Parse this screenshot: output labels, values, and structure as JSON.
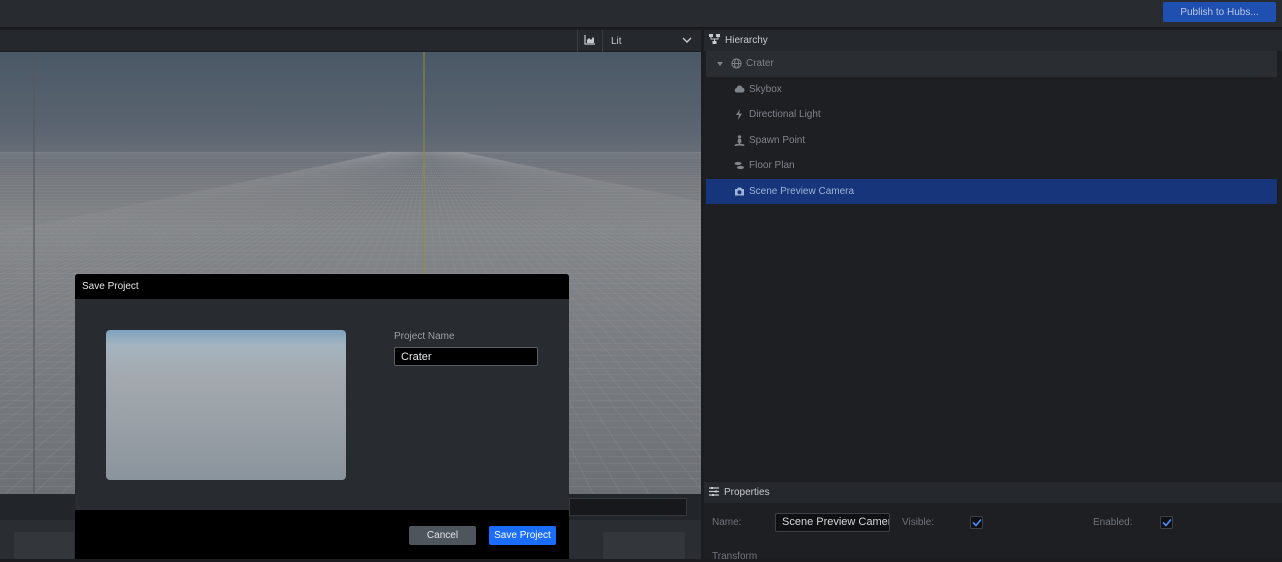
{
  "topbar": {
    "publish_label": "Publish to Hubs..."
  },
  "viewport": {
    "render_mode": "Lit",
    "icons": {
      "stats": "stats-chart-icon",
      "dropdown": "chevron-down-icon"
    }
  },
  "hierarchy": {
    "title": "Hierarchy",
    "root": {
      "label": "Crater",
      "icon": "globe-icon"
    },
    "children": [
      {
        "label": "Skybox",
        "icon": "cloud-icon"
      },
      {
        "label": "Directional Light",
        "icon": "bolt-icon"
      },
      {
        "label": "Spawn Point",
        "icon": "person-icon"
      },
      {
        "label": "Floor Plan",
        "icon": "shoe-prints-icon"
      },
      {
        "label": "Scene Preview Camera",
        "icon": "camera-icon",
        "selected": true
      }
    ]
  },
  "properties": {
    "title": "Properties",
    "name_label": "Name:",
    "name_value": "Scene Preview Camera",
    "visible_label": "Visible:",
    "visible": true,
    "enabled_label": "Enabled:",
    "enabled": true,
    "section_label": "Transform"
  },
  "modal": {
    "title": "Save Project",
    "field_label": "Project Name",
    "project_name": "Crater",
    "cancel_label": "Cancel",
    "save_label": "Save Project"
  },
  "colors": {
    "accent": "#1a6dff",
    "selection": "#16357a",
    "publish": "#1f4fb0"
  }
}
